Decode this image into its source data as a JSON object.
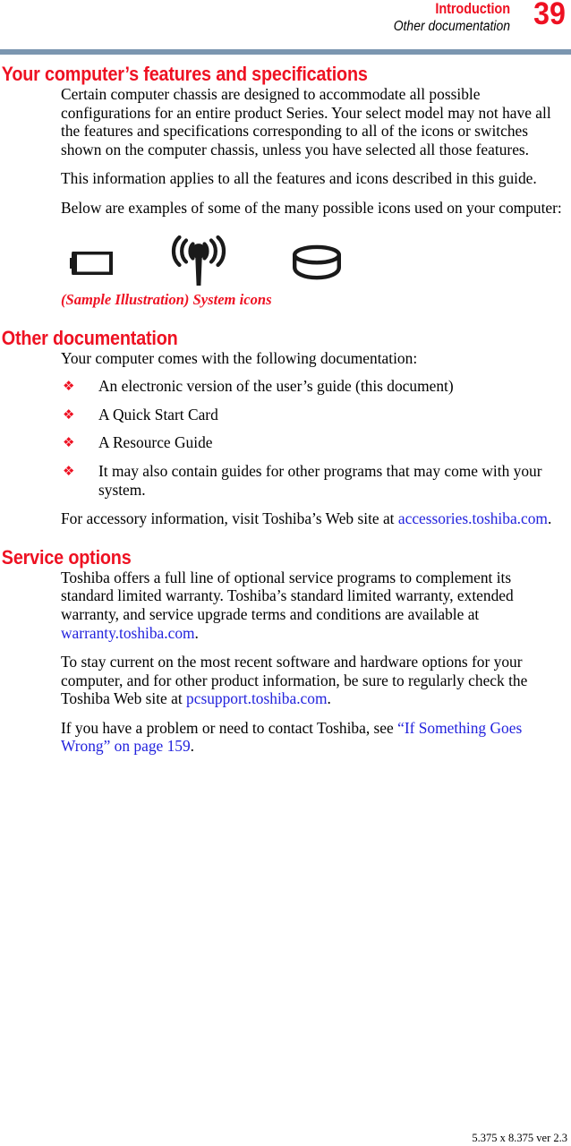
{
  "header": {
    "chapter": "Introduction",
    "section": "Other documentation",
    "page_number": "39",
    "rule_color": "#7b96b0",
    "accent_color": "#ee1122"
  },
  "sections": [
    {
      "heading": "Your computer’s features and specifications",
      "paragraphs": [
        "Certain computer chassis are designed to accommodate all possible configurations for an entire product Series. Your select model may not have all the features and specifications corresponding to all of the icons or switches shown on the computer chassis, unless you have selected all those features.",
        "This information applies to all the features and icons described in this guide.",
        "Below are examples of some of the many possible icons used on your computer:"
      ]
    }
  ],
  "figure": {
    "icons": [
      {
        "name": "battery-icon",
        "label": "battery"
      },
      {
        "name": "wireless-antenna-icon",
        "label": "wireless antenna"
      },
      {
        "name": "disk-drive-icon",
        "label": "disk drive"
      }
    ],
    "caption": "(Sample Illustration) System icons",
    "caption_color": "#ee1122"
  },
  "other_documentation": {
    "heading": "Other documentation",
    "intro": "Your computer comes with the following documentation:",
    "bullet_glyph": "❖",
    "bullets": [
      "An electronic version of the user’s guide (this document)",
      "A Quick Start Card",
      "A Resource Guide",
      "It may also contain guides for other programs that may come with your system."
    ],
    "accessory_text_before": "For accessory information, visit Toshiba’s Web site at ",
    "accessory_link": "accessories.toshiba.com",
    "accessory_text_after": "."
  },
  "service_options": {
    "heading": "Service options",
    "para1_before": "Toshiba offers a full line of optional service programs to complement its standard limited warranty. Toshiba’s standard limited warranty, extended warranty, and service upgrade terms and conditions are available at ",
    "para1_link": "warranty.toshiba.com",
    "para1_after": ".",
    "para2_before": "To stay current on the most recent software and hardware options for your computer, and for other product information, be sure to regularly check the Toshiba Web site at ",
    "para2_link": "pcsupport.toshiba.com",
    "para2_after": ".",
    "para3_before": "If you have a problem or need to contact Toshiba, see ",
    "para3_link": "“If Something Goes Wrong” on page 159",
    "para3_after": ".",
    "link_color": "#2222dd"
  },
  "footer": {
    "text": "5.375 x 8.375 ver 2.3"
  }
}
